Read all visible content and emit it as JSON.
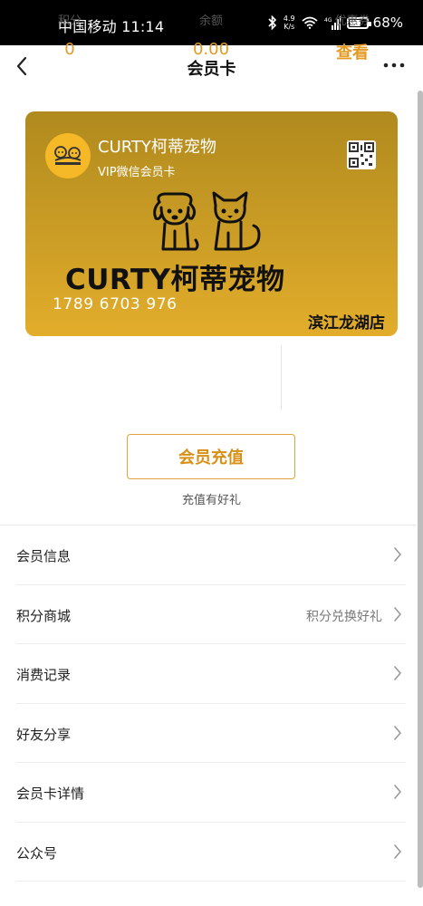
{
  "status_bar": {
    "carrier_time": "中国移动 11:14",
    "net_speed_value": "4.9",
    "net_speed_unit": "K/s",
    "battery_percent": 68,
    "battery_label": "68%",
    "signal_type": "4G"
  },
  "nav": {
    "title": "会员卡"
  },
  "card": {
    "brand_name": "CURTY柯蒂宠物",
    "level": "VIP微信会员卡",
    "logo_text": "CURTY柯蒂宠物",
    "card_number": "1789 6703 976",
    "store": "滨江龙湖店",
    "colors": {
      "gradient_top": "#b08a1e",
      "gradient_bottom": "#e2ad2b"
    }
  },
  "stats": {
    "points_label": "积分",
    "points_value": "0",
    "balance_label": "余额",
    "balance_value": "0.00",
    "coupon_label": "优惠券",
    "coupon_value": "查看",
    "accent_color": "#e39a23"
  },
  "recharge": {
    "button_label": "会员充值",
    "tip": "充值有好礼"
  },
  "menu": [
    {
      "label": "会员信息",
      "extra": ""
    },
    {
      "label": "积分商城",
      "extra": "积分兑换好礼"
    },
    {
      "label": "消费记录",
      "extra": ""
    },
    {
      "label": "好友分享",
      "extra": ""
    },
    {
      "label": "会员卡详情",
      "extra": ""
    },
    {
      "label": "公众号",
      "extra": ""
    }
  ],
  "icons": [
    "back-icon",
    "more-icon",
    "bluetooth-icon",
    "wifi-icon",
    "signal-icon",
    "battery-icon",
    "qr-code-icon",
    "chevron-right-icon"
  ]
}
